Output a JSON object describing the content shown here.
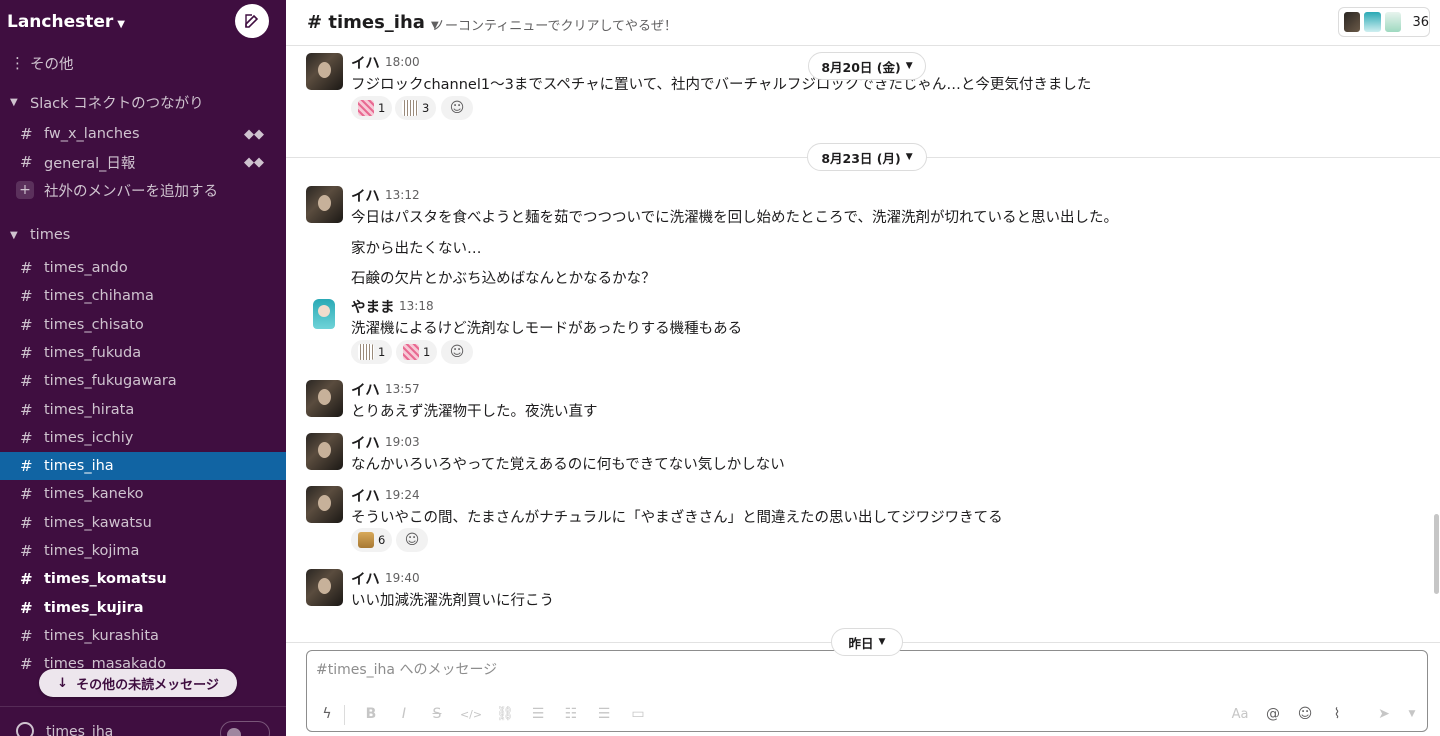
{
  "sidebar": {
    "workspace_name": "Lanchester",
    "other_label": "その他",
    "connect_section": "Slack コネクトのつながり",
    "connect_channels": [
      {
        "name": "fw_x_lanches"
      },
      {
        "name": "general_日報"
      }
    ],
    "add_external": "社外のメンバーを追加する",
    "times_section": "times",
    "channels": [
      {
        "name": "times_ando",
        "bold": false,
        "active": false
      },
      {
        "name": "times_chihama",
        "bold": false,
        "active": false
      },
      {
        "name": "times_chisato",
        "bold": false,
        "active": false
      },
      {
        "name": "times_fukuda",
        "bold": false,
        "active": false
      },
      {
        "name": "times_fukugawara",
        "bold": false,
        "active": false
      },
      {
        "name": "times_hirata",
        "bold": false,
        "active": false
      },
      {
        "name": "times_icchiy",
        "bold": false,
        "active": false
      },
      {
        "name": "times_iha",
        "bold": false,
        "active": true
      },
      {
        "name": "times_kaneko",
        "bold": false,
        "active": false
      },
      {
        "name": "times_kawatsu",
        "bold": false,
        "active": false
      },
      {
        "name": "times_kojima",
        "bold": false,
        "active": false
      },
      {
        "name": "times_komatsu",
        "bold": true,
        "active": false
      },
      {
        "name": "times_kujira",
        "bold": true,
        "active": false
      },
      {
        "name": "times_kurashita",
        "bold": false,
        "active": false
      },
      {
        "name": "times_masakado",
        "bold": false,
        "active": false
      }
    ],
    "unread_pill": "その他の未読メッセージ",
    "huddle_label": "times_iha"
  },
  "header": {
    "channel": "# times_iha",
    "topic": "ノーコンティニューでクリアしてやるぜ！",
    "member_count": "36"
  },
  "days": [
    "8月20日 (金)",
    "8月23日 (月)",
    "昨日"
  ],
  "messages": [
    {
      "user": "イハ",
      "time": "18:00",
      "lines": [
        "フジロックchannel1〜3までスペチャに置いて、社内でバーチャルフジロックできたじゃん…と今更気付きました"
      ],
      "reactions": [
        {
          "count": "1"
        },
        {
          "count": "3"
        }
      ]
    },
    {
      "user": "イハ",
      "time": "13:12",
      "lines": [
        "今日はパスタを食べようと麺を茹でつつついでに洗濯機を回し始めたところで、洗濯洗剤が切れていると思い出した。",
        "家から出たくない…",
        "石鹸の欠片とかぶち込めばなんとかなるかな？"
      ]
    },
    {
      "user": "やまま",
      "time": "13:18",
      "lines": [
        "洗濯機によるけど洗剤なしモードがあったりする機種もある"
      ],
      "reactions": [
        {
          "count": "1"
        },
        {
          "count": "1"
        }
      ]
    },
    {
      "user": "イハ",
      "time": "13:57",
      "lines": [
        "とりあえず洗濯物干した。夜洗い直す"
      ]
    },
    {
      "user": "イハ",
      "time": "19:03",
      "lines": [
        "なんかいろいろやってた覚えあるのに何もできてない気しかしない"
      ]
    },
    {
      "user": "イハ",
      "time": "19:24",
      "lines": [
        "そういやこの間、たまさんがナチュラルに「やまざきさん」と間違えたの思い出してジワジワきてる"
      ],
      "reactions": [
        {
          "count": "6"
        }
      ]
    },
    {
      "user": "イハ",
      "time": "19:40",
      "lines": [
        "いい加減洗濯洗剤買いに行こう"
      ]
    }
  ],
  "composer": {
    "placeholder": "#times_iha へのメッセージ",
    "format_label": "Aa"
  },
  "colors": {
    "sidebar_bg": "#3f0e40",
    "active_channel": "#1164a3"
  }
}
